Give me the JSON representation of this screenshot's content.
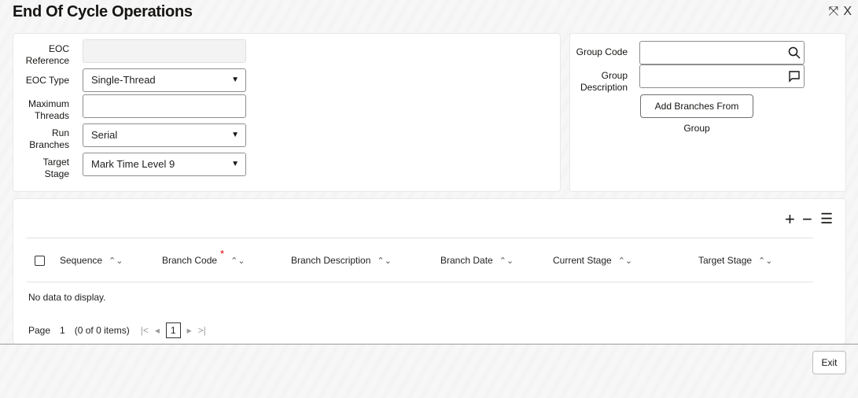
{
  "window": {
    "title": "End Of Cycle Operations",
    "controls": {
      "resize": "⤧",
      "close": "X"
    }
  },
  "form": {
    "eoc_reference": {
      "label": "EOC Reference",
      "value": ""
    },
    "eoc_type": {
      "label": "EOC Type",
      "value": "Single-Thread"
    },
    "max_threads": {
      "label": "Maximum Threads",
      "value": ""
    },
    "run_branches": {
      "label": "Run Branches",
      "value": "Serial"
    },
    "target_stage": {
      "label": "Target Stage",
      "value": "Mark Time Level 9"
    },
    "group_code": {
      "label": "Group Code",
      "value": ""
    },
    "group_description": {
      "label": "Group Description",
      "value": ""
    },
    "add_branches_button": "Add Branches From Group"
  },
  "grid": {
    "toolbar": {
      "add": "+",
      "remove": "−",
      "columns": "☰"
    },
    "columns": [
      "Sequence",
      "Branch Code",
      "Branch Description",
      "Branch Date",
      "Current Stage",
      "Target Stage"
    ],
    "required_mark": "*",
    "sort_glyph": "⌃⌄",
    "empty_message": "No data to display.",
    "pager": {
      "page_label": "Page",
      "page_value": "1",
      "items_info": "(0 of 0 items)",
      "current_page": "1"
    }
  },
  "footer": {
    "exit_button": "Exit"
  }
}
